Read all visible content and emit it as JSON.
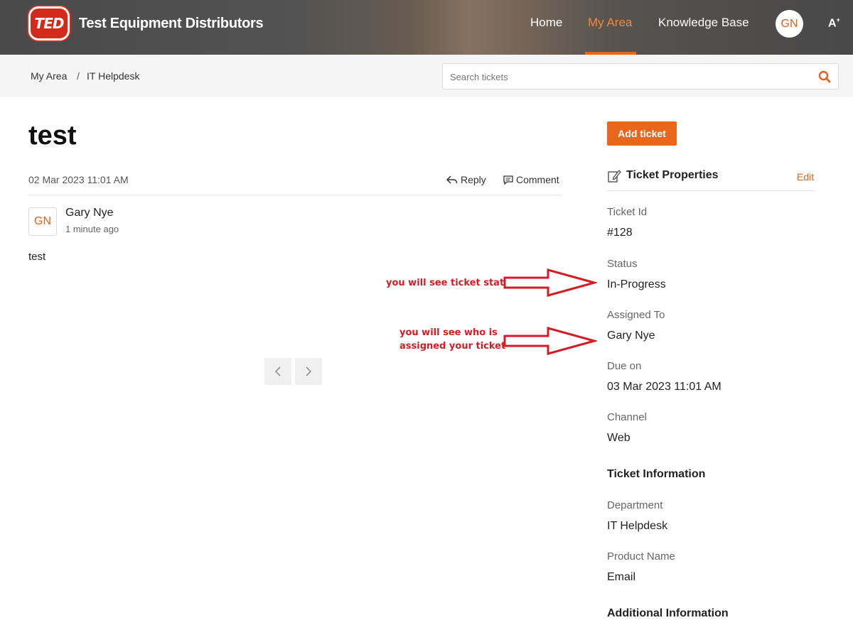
{
  "header": {
    "logo_text": "TED",
    "brand": "Test Equipment Distributors",
    "nav": [
      {
        "label": "Home"
      },
      {
        "label": "My Area"
      },
      {
        "label": "Knowledge Base"
      }
    ],
    "avatar_initials": "GN",
    "font_size_label": "A",
    "active_nav": "My Area",
    "accent_color": "#e8671d"
  },
  "breadcrumb": {
    "items": [
      "My Area",
      "IT Helpdesk"
    ],
    "separator": "/"
  },
  "search": {
    "placeholder": "Search tickets",
    "value": ""
  },
  "ticket": {
    "title": "test",
    "date": "02 Mar 2023 11:01 AM",
    "reply_label": "Reply",
    "comment_label": "Comment",
    "author_initials": "GN",
    "author": "Gary Nye",
    "time_ago": "1 minute ago",
    "body": "test"
  },
  "pager": {
    "prev_icon": "chevron-left-icon",
    "next_icon": "chevron-right-icon"
  },
  "annotations": {
    "status_note": "you will see ticket status",
    "assigned_note_line1": "you will see who is",
    "assigned_note_line2": "assigned your ticket",
    "color": "#d41c24"
  },
  "sidebar": {
    "add_ticket_label": "Add ticket",
    "properties_title": "Ticket Properties",
    "edit_label": "Edit",
    "properties": [
      {
        "label": "Ticket Id",
        "value": "#128"
      },
      {
        "label": "Status",
        "value": "In-Progress"
      },
      {
        "label": "Assigned To",
        "value": "Gary Nye"
      },
      {
        "label": "Due on",
        "value": "03 Mar 2023 11:01 AM"
      },
      {
        "label": "Channel",
        "value": "Web"
      }
    ],
    "ticket_information_heading": "Ticket Information",
    "information": [
      {
        "label": "Department",
        "value": "IT Helpdesk"
      },
      {
        "label": "Product Name",
        "value": "Email"
      }
    ],
    "additional_information_heading": "Additional Information"
  }
}
